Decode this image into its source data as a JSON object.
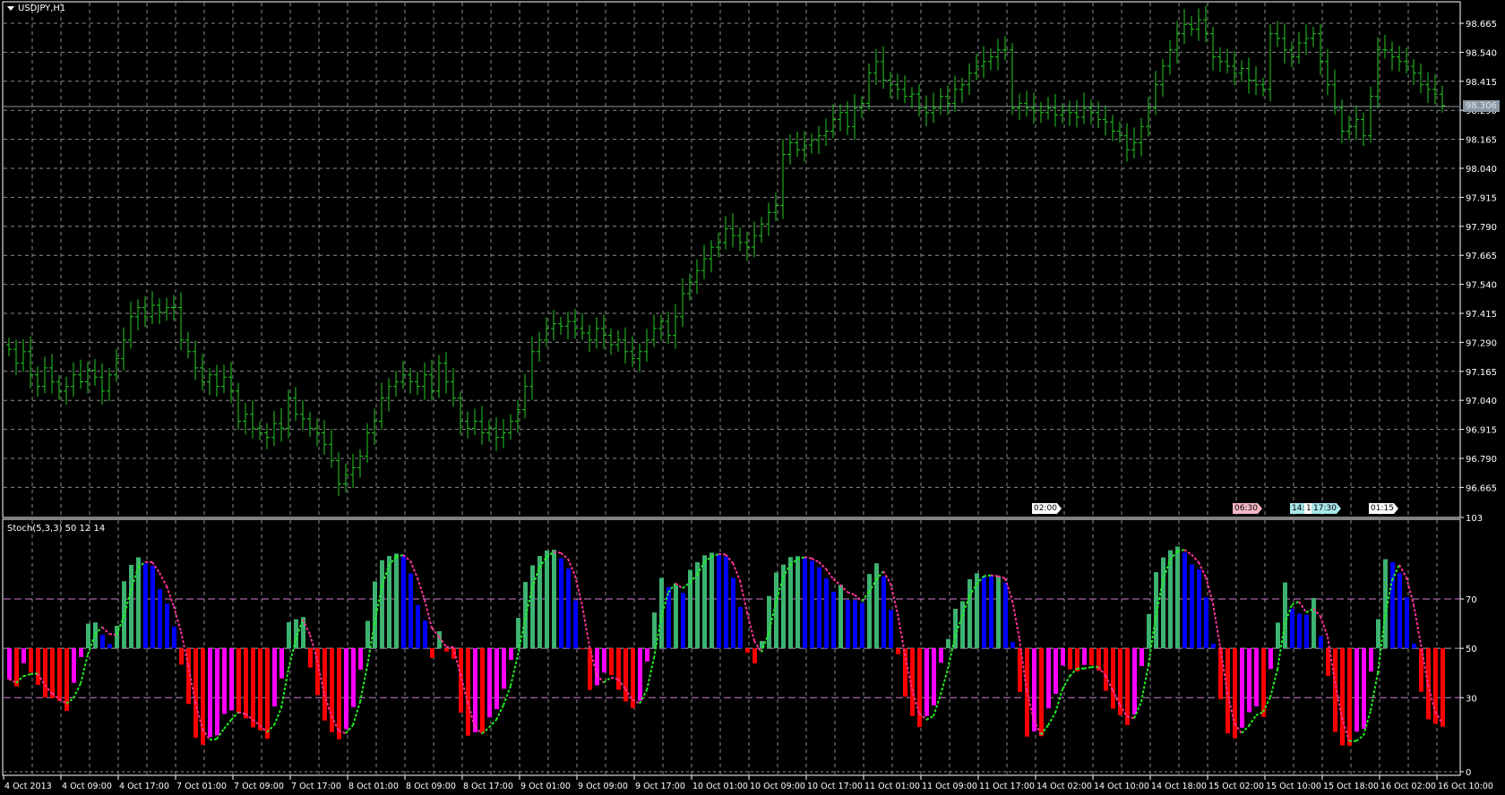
{
  "window": {
    "symbol_label": "USDJPY,H1"
  },
  "indicator": {
    "label": "Stoch(5,3,3) 50 12 14",
    "levels": [
      "103",
      "70",
      "50",
      "30",
      "0"
    ]
  },
  "current_price": "98.306",
  "events": [
    {
      "label": "02:00",
      "color": "#ffffff",
      "bar": 143
    },
    {
      "label": "06:30",
      "color": "#f4b8c4",
      "bar": 171
    },
    {
      "label": "14:",
      "color": "#a8e6ea",
      "bar": 179
    },
    {
      "label": "1",
      "color": "#ffffff",
      "bar": 181
    },
    {
      "label": "17:30",
      "color": "#a8e6ea",
      "bar": 182
    },
    {
      "label": "01:15",
      "color": "#ffffff",
      "bar": 190
    }
  ],
  "colors": {
    "bar": "#22cc22",
    "grid": "#8c8c8c",
    "hist_up": "#3cb371",
    "hist_down_above": "#0000ff",
    "hist_down": "#ff0000",
    "hist_up_below": "#ff00ff",
    "signal_up": "#22ee22",
    "signal_down": "#ff3399",
    "level": "#d080d0"
  },
  "chart_data": {
    "type": "ohlc-bar",
    "symbol": "USDJPY",
    "timeframe": "H1",
    "ylim": [
      96.645,
      98.74
    ],
    "price_ticks": [
      "98.665",
      "98.540",
      "98.415",
      "98.290",
      "98.165",
      "98.040",
      "97.915",
      "97.790",
      "97.665",
      "97.540",
      "97.415",
      "97.290",
      "97.165",
      "97.040",
      "96.915",
      "96.790",
      "96.665"
    ],
    "time_labels": [
      "4 Oct 2013",
      "4 Oct 09:00",
      "4 Oct 17:00",
      "7 Oct 01:00",
      "7 Oct 09:00",
      "7 Oct 17:00",
      "8 Oct 01:00",
      "8 Oct 09:00",
      "8 Oct 17:00",
      "9 Oct 01:00",
      "9 Oct 09:00",
      "9 Oct 17:00",
      "10 Oct 01:00",
      "10 Oct 09:00",
      "10 Oct 17:00",
      "11 Oct 01:00",
      "11 Oct 09:00",
      "11 Oct 17:00",
      "14 Oct 02:00",
      "14 Oct 10:00",
      "14 Oct 18:00",
      "15 Oct 02:00",
      "15 Oct 10:00",
      "15 Oct 18:00",
      "16 Oct 02:00",
      "16 Oct 10:00"
    ],
    "close": [
      97.26,
      97.2,
      97.25,
      97.15,
      97.1,
      97.18,
      97.12,
      97.08,
      97.1,
      97.15,
      97.12,
      97.17,
      97.14,
      97.08,
      97.15,
      97.22,
      97.3,
      97.4,
      97.44,
      97.4,
      97.45,
      97.42,
      97.44,
      97.44,
      97.3,
      97.25,
      97.18,
      97.12,
      97.15,
      97.1,
      97.14,
      97.08,
      96.95,
      96.98,
      96.92,
      96.9,
      96.88,
      96.94,
      96.92,
      97.05,
      96.98,
      96.96,
      96.92,
      96.9,
      96.85,
      96.78,
      96.68,
      96.72,
      96.75,
      96.8,
      96.9,
      96.95,
      97.05,
      97.1,
      97.12,
      97.15,
      97.12,
      97.1,
      97.15,
      97.08,
      97.2,
      97.12,
      97.05,
      96.95,
      96.92,
      96.95,
      96.9,
      96.92,
      96.88,
      96.9,
      96.95,
      97.0,
      97.1,
      97.25,
      97.3,
      97.35,
      97.37,
      97.36,
      97.38,
      97.35,
      97.33,
      97.3,
      97.35,
      97.32,
      97.28,
      97.3,
      97.25,
      97.22,
      97.25,
      97.3,
      97.35,
      97.38,
      97.32,
      97.4,
      97.5,
      97.55,
      97.6,
      97.65,
      97.7,
      97.72,
      97.78,
      97.75,
      97.72,
      97.7,
      97.75,
      97.8,
      97.85,
      97.88,
      98.1,
      98.15,
      98.12,
      98.14,
      98.16,
      98.18,
      98.2,
      98.25,
      98.28,
      98.22,
      98.3,
      98.32,
      98.45,
      98.5,
      98.42,
      98.4,
      98.38,
      98.35,
      98.36,
      98.3,
      98.28,
      98.3,
      98.35,
      98.32,
      98.38,
      98.4,
      98.45,
      98.48,
      98.5,
      98.52,
      98.55,
      98.55,
      98.3,
      98.32,
      98.3,
      98.29,
      98.28,
      98.3,
      98.27,
      98.29,
      98.28,
      98.26,
      98.3,
      98.28,
      98.25,
      98.24,
      98.2,
      98.18,
      98.12,
      98.15,
      98.22,
      98.3,
      98.4,
      98.48,
      98.55,
      98.62,
      98.66,
      98.64,
      98.68,
      98.62,
      98.52,
      98.5,
      98.48,
      98.45,
      98.47,
      98.42,
      98.4,
      98.38,
      98.62,
      98.6,
      98.55,
      98.52,
      98.58,
      98.6,
      98.62,
      98.5,
      98.4,
      98.3,
      98.2,
      98.22,
      98.25,
      98.18,
      98.35,
      98.55,
      98.55,
      98.52,
      98.5,
      98.48,
      98.45,
      98.4,
      98.38,
      98.36,
      98.31
    ],
    "stochastic": {
      "k": 5,
      "d": 3,
      "slowing": 3,
      "ylim": [
        0,
        103
      ],
      "levels": [
        70,
        50,
        30
      ]
    }
  }
}
